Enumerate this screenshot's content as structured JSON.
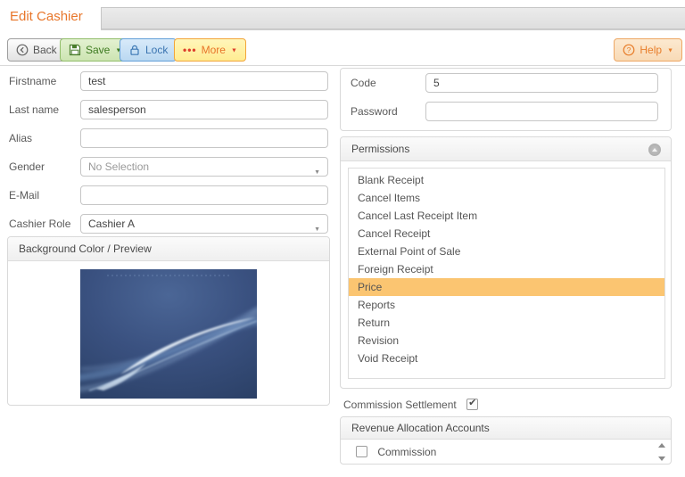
{
  "tab": {
    "title": "Edit Cashier"
  },
  "toolbar": {
    "back": "Back",
    "save": "Save",
    "lock": "Lock",
    "more": "More",
    "more_dots": "•••",
    "help": "Help"
  },
  "left_form": {
    "fields": [
      {
        "label": "Firstname",
        "value": "test",
        "type": "text"
      },
      {
        "label": "Last name",
        "value": "salesperson",
        "type": "text"
      },
      {
        "label": "Alias",
        "value": "",
        "type": "text"
      },
      {
        "label": "Gender",
        "value": "No Selection",
        "type": "select",
        "muted": true
      },
      {
        "label": "E-Mail",
        "value": "",
        "type": "text"
      },
      {
        "label": "Cashier Role",
        "value": "Cashier A",
        "type": "select"
      }
    ]
  },
  "right_form": {
    "fields": [
      {
        "label": "Code",
        "value": "5"
      },
      {
        "label": "Password",
        "value": ""
      }
    ]
  },
  "background_panel": {
    "title": "Background Color / Preview"
  },
  "permissions": {
    "title": "Permissions",
    "items": [
      {
        "label": "Blank Receipt"
      },
      {
        "label": "Cancel Items"
      },
      {
        "label": "Cancel Last Receipt Item"
      },
      {
        "label": "Cancel Receipt"
      },
      {
        "label": "External Point of Sale"
      },
      {
        "label": "Foreign Receipt"
      },
      {
        "label": "Price",
        "selected": true
      },
      {
        "label": "Reports"
      },
      {
        "label": "Return"
      },
      {
        "label": "Revision"
      },
      {
        "label": "Void Receipt"
      }
    ]
  },
  "commission": {
    "label": "Commission Settlement",
    "checked": true
  },
  "revenue": {
    "title": "Revenue Allocation Accounts",
    "rows": [
      {
        "label": "Commission",
        "checked": false
      }
    ]
  },
  "colors": {
    "accent_orange": "#e8762a",
    "selection_highlight": "#fbc571",
    "save_green": "#3d7a1f",
    "lock_blue": "#3a74b0"
  }
}
